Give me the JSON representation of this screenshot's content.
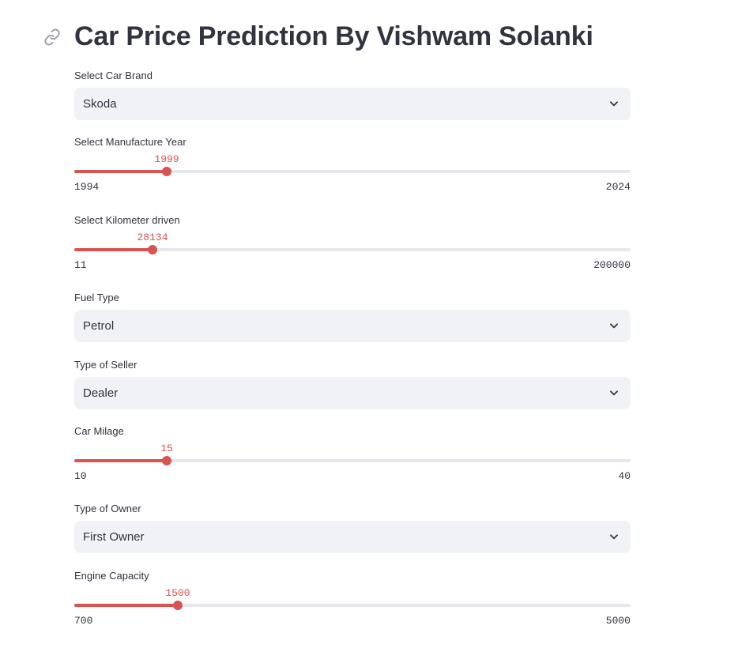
{
  "title": "Car Price Prediction By Vishwam Solanki",
  "accent_color": "#d9534f",
  "fields": {
    "brand": {
      "label": "Select Car Brand",
      "value": "Skoda"
    },
    "year": {
      "label": "Select Manufacture Year",
      "value": "1999",
      "min": "1994",
      "max": "2024"
    },
    "km": {
      "label": "Select Kilometer driven",
      "value": "28134",
      "min": "11",
      "max": "200000"
    },
    "fuel": {
      "label": "Fuel Type",
      "value": "Petrol"
    },
    "seller": {
      "label": "Type of Seller",
      "value": "Dealer"
    },
    "mileage": {
      "label": "Car Milage",
      "value": "15",
      "min": "10",
      "max": "40"
    },
    "owner": {
      "label": "Type of Owner",
      "value": "First Owner"
    },
    "engine": {
      "label": "Engine Capacity",
      "value": "1500",
      "min": "700",
      "max": "5000"
    }
  }
}
